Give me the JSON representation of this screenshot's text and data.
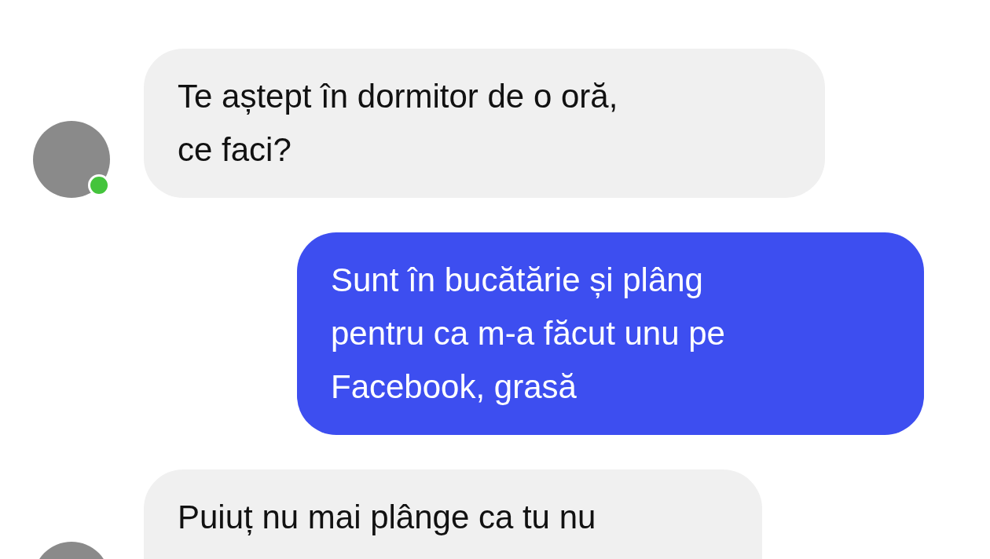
{
  "messages": [
    {
      "kind": "incoming",
      "text": "Te aștept în dormitor de o oră,\nce faci?",
      "avatar": {
        "online": true
      }
    },
    {
      "kind": "outgoing",
      "text": "Sunt în bucătărie și plâng\npentru ca m-a făcut unu pe\nFacebook, grasă"
    },
    {
      "kind": "incoming",
      "text": "Puiuț nu mai plânge ca tu nu"
    }
  ]
}
